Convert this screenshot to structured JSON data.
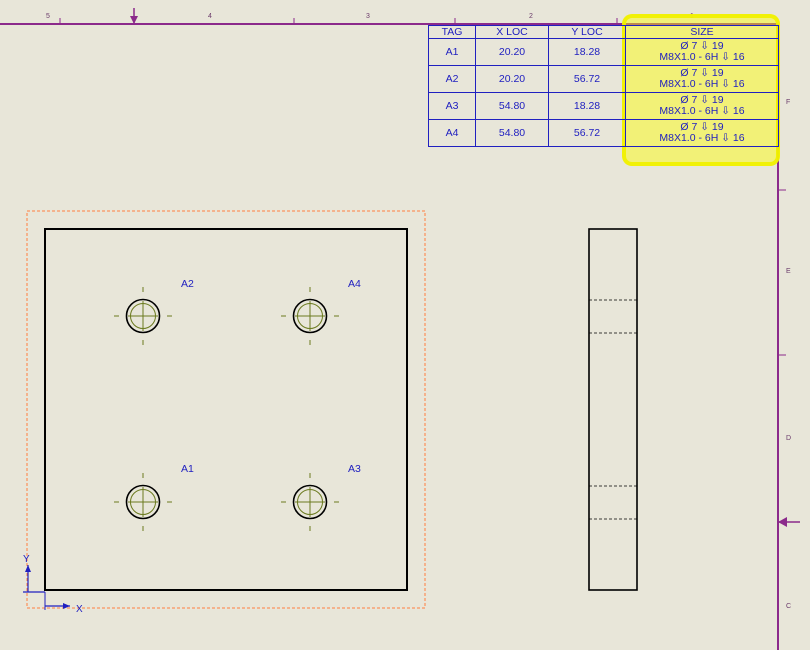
{
  "top_ruler": {
    "zones": [
      "5",
      "4",
      "3",
      "2",
      "1"
    ]
  },
  "right_ruler": {
    "zones": [
      "F",
      "E",
      "D",
      "C"
    ]
  },
  "hole_table": {
    "headers": {
      "tag": "TAG",
      "xloc": "X LOC",
      "yloc": "Y LOC",
      "size": "SIZE"
    },
    "rows": [
      {
        "tag": "A1",
        "x": "20.20",
        "y": "18.28",
        "size_line1": "Ø 7 ⇩ 19",
        "size_line2": "M8X1.0 - 6H ⇩ 16"
      },
      {
        "tag": "A2",
        "x": "20.20",
        "y": "56.72",
        "size_line1": "Ø 7 ⇩ 19",
        "size_line2": "M8X1.0 - 6H ⇩ 16"
      },
      {
        "tag": "A3",
        "x": "54.80",
        "y": "18.28",
        "size_line1": "Ø 7 ⇩ 19",
        "size_line2": "M8X1.0 - 6H ⇩ 16"
      },
      {
        "tag": "A4",
        "x": "54.80",
        "y": "56.72",
        "size_line1": "Ø 7 ⇩ 19",
        "size_line2": "M8X1.0 - 6H ⇩ 16"
      }
    ]
  },
  "hole_labels": {
    "a1": "A1",
    "a2": "A2",
    "a3": "A3",
    "a4": "A4"
  },
  "axis": {
    "x": "X",
    "y": "Y"
  },
  "colors": {
    "background": "#e8e6d9",
    "border": "#8b2a8b",
    "annotation_blue": "#2020c0",
    "selection_orange": "#ff7f3f",
    "centerline_olive": "#6b7a1e",
    "highlight_yellow": "#ffff00"
  }
}
